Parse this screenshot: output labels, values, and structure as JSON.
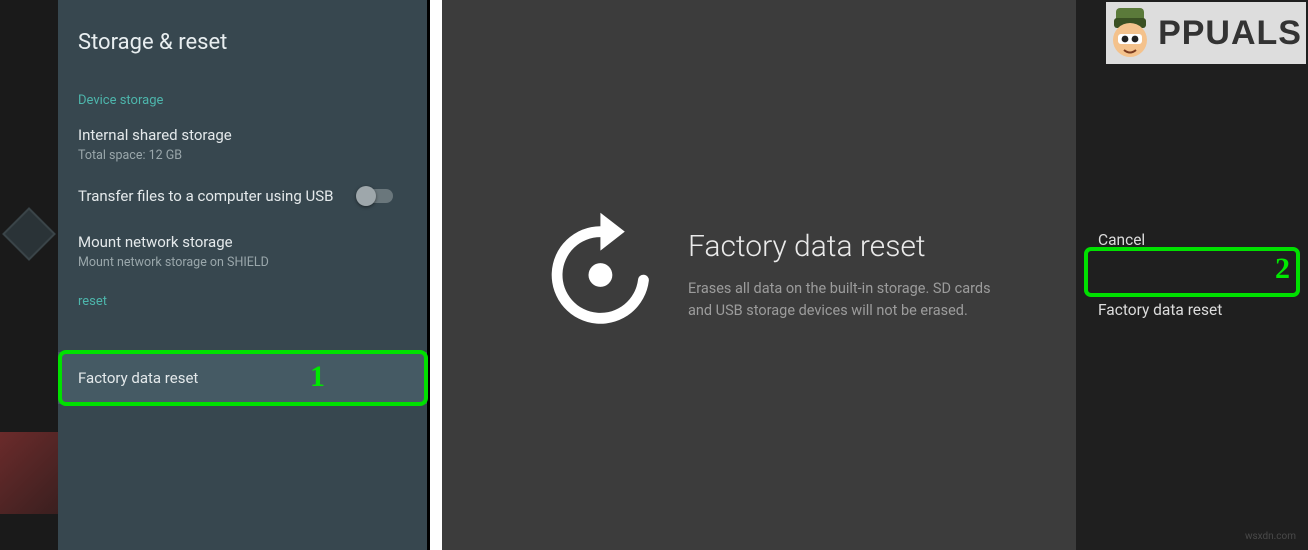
{
  "left": {
    "title": "Storage & reset",
    "device_storage_label": "Device storage",
    "internal_title": "Internal shared storage",
    "internal_sub": "Total space: 12 GB",
    "transfer_label": "Transfer files to a computer using USB",
    "mount_title": "Mount network storage",
    "mount_sub": "Mount network storage on SHIELD",
    "reset_label": "reset",
    "factory_reset_item": "Factory data reset"
  },
  "right": {
    "title": "Factory data reset",
    "description": "Erases all data on the built-in storage. SD cards and USB storage devices will not be erased.",
    "cancel_label": "Cancel",
    "confirm_label": "Factory data reset"
  },
  "annotations": {
    "num1": "1",
    "num2": "2"
  },
  "branding": {
    "logo_text": "PPUALS",
    "watermark": "wsxdn.com"
  }
}
